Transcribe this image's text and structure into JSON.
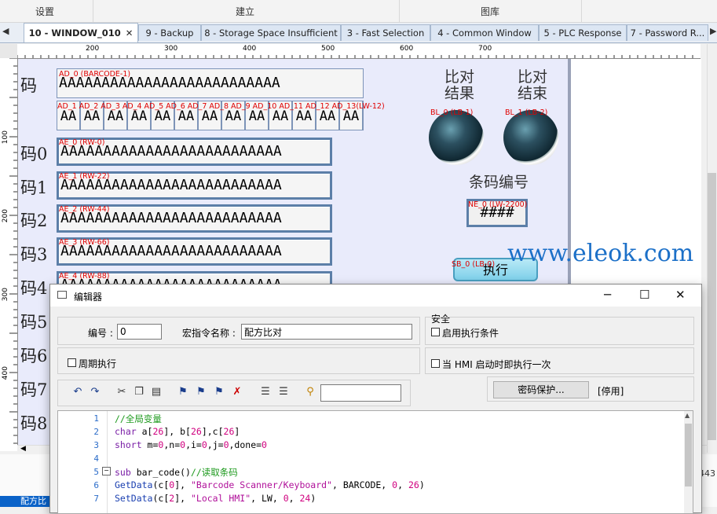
{
  "menu": {
    "items": [
      "设置",
      "建立",
      "图库"
    ]
  },
  "tabs": [
    {
      "label": "10 - WINDOW_010",
      "active": true
    },
    {
      "label": "9 - Backup"
    },
    {
      "label": "8 - Storage Space Insufficient"
    },
    {
      "label": "3 - Fast Selection"
    },
    {
      "label": "4 - Common Window"
    },
    {
      "label": "5 - PLC Response"
    },
    {
      "label": "7 - Password R..."
    }
  ],
  "ruler": {
    "h_ticks": [
      "200",
      "300",
      "400",
      "500",
      "600",
      "700"
    ],
    "v_ticks": [
      "100",
      "200",
      "300",
      "400"
    ]
  },
  "canvas": {
    "left_chars": [
      "码",
      "码0",
      "码1",
      "码2",
      "码3",
      "码4",
      "码5",
      "码6",
      "码7",
      "码8"
    ],
    "barcode_label": "AD_0 (BARCODE-1)",
    "barcode_text": "AAAAAAAAAAAAAAAAAAAAAAAAAA",
    "small_labels": "AD_1 AD_2 AD_3 AD_4 AD_5 AD_6 AD_7 AD_8 AD_9 AD_10 AD_11 AD_12 AD_13(LW-12)",
    "small_cells": [
      "AA",
      "AA",
      "AA",
      "AA",
      "AA",
      "AA",
      "AA",
      "AA",
      "AA",
      "AA",
      "AA",
      "AA",
      "AA"
    ],
    "rows": [
      {
        "label": "AE_0 (RW-0)",
        "text": "AAAAAAAAAAAAAAAAAAAAAAAAAA"
      },
      {
        "label": "AE_1 (RW-22)",
        "text": "AAAAAAAAAAAAAAAAAAAAAAAAAA"
      },
      {
        "label": "AE_2 (RW-44)",
        "text": "AAAAAAAAAAAAAAAAAAAAAAAAAA"
      },
      {
        "label": "AE_3 (RW-66)",
        "text": "AAAAAAAAAAAAAAAAAAAAAAAAAA"
      },
      {
        "label": "AE_4 (RW-88)",
        "text": "AAAAAAAAAAAAAAAAAAAAAAAAAA"
      }
    ],
    "compare_result_title": "比对\n结果",
    "compare_end_title": "比对\n结束",
    "lamp0_label": "BL_0 (LB-1)",
    "lamp1_label": "BL_1 (LB-2)",
    "barcode_no_title": "条码编号",
    "ne_label": "NE_0 (LW-2200)",
    "ne_value": "####",
    "sb_label": "SB_0 (LB-0)",
    "exec_label": "执行",
    "watermark": "www.eleok.com"
  },
  "status": {
    "left_text": "配方比",
    "right_text": "443"
  },
  "editor": {
    "title": "编辑器",
    "number_label": "编号 :",
    "number_value": "0",
    "macro_name_label": "宏指令名称 :",
    "macro_name_value": "配方比对",
    "periodic_label": "周期执行",
    "security_title": "安全",
    "enable_cond_label": "启用执行条件",
    "run_once_label": "当 HMI 启动时即执行一次",
    "password_btn": "密码保护...",
    "disabled_text": "[停用]",
    "code_lines": [
      {
        "n": "1",
        "text": "//全局变量"
      },
      {
        "n": "2",
        "text": "char a[26], b[26],c[26]"
      },
      {
        "n": "3",
        "text": "short m=0,n=0,i=0,j=0,done=0"
      },
      {
        "n": "4",
        "text": ""
      },
      {
        "n": "5",
        "text": "sub bar_code()//读取条码"
      },
      {
        "n": "6",
        "text": "GetData(c[0], \"Barcode Scanner/Keyboard\", BARCODE, 0, 26)"
      },
      {
        "n": "7",
        "text": "SetData(c[2], \"Local HMI\", LW, 0, 24)"
      }
    ]
  }
}
